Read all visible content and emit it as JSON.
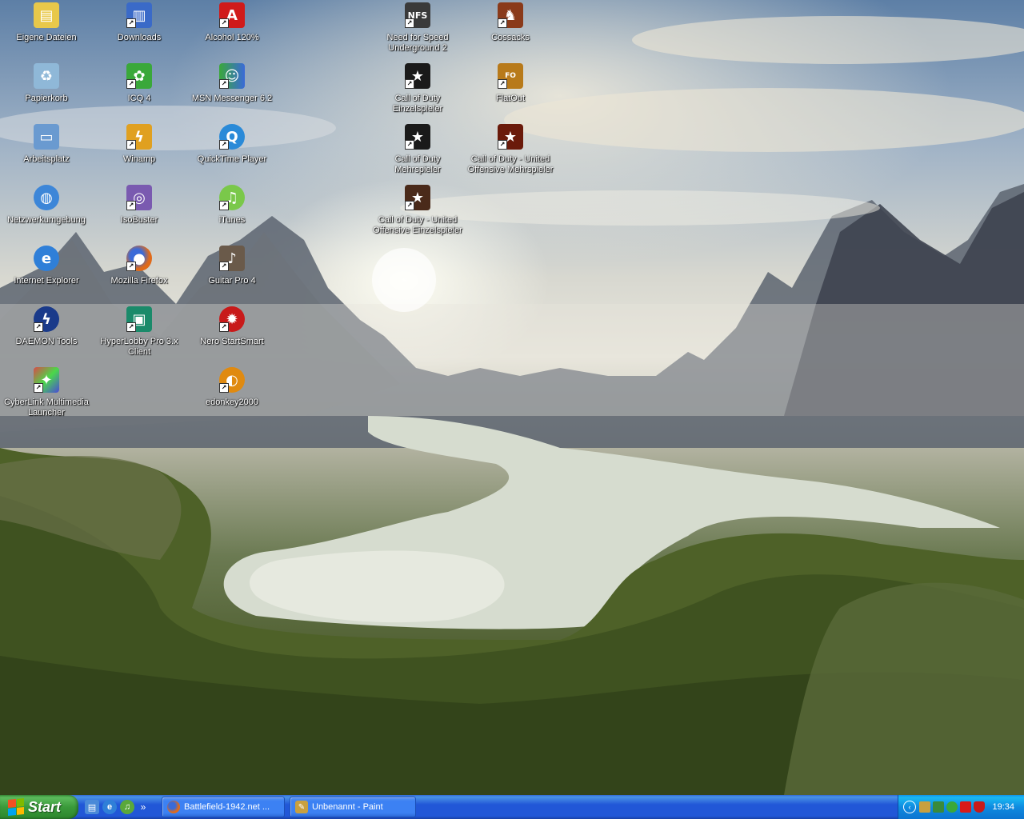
{
  "desktop": {
    "icons": [
      {
        "label": "Eigene Dateien",
        "icon": "my-documents-icon",
        "color": "#e8c84a"
      },
      {
        "label": "Papierkorb",
        "icon": "recycle-bin-icon",
        "color": "#8fb8d8"
      },
      {
        "label": "Arbeitsplatz",
        "icon": "my-computer-icon",
        "color": "#6a9ad0"
      },
      {
        "label": "Netzwerkumgebung",
        "icon": "network-places-icon",
        "color": "#3d86d8"
      },
      {
        "label": "Internet Explorer",
        "icon": "internet-explorer-icon",
        "color": "#2f7fd8"
      },
      {
        "label": "DAEMON Tools",
        "icon": "daemon-tools-icon",
        "color": "#1a3a8a"
      },
      {
        "label": "CyberLink Multimedia Launcher",
        "icon": "cyberlink-icon",
        "color": "#d84a4a"
      },
      {
        "label": "Downloads",
        "icon": "downloads-folder-icon",
        "color": "#3a6ac8"
      },
      {
        "label": "ICQ 4",
        "icon": "icq-flower-icon",
        "color": "#3aa83a"
      },
      {
        "label": "Winamp",
        "icon": "winamp-icon",
        "color": "#e0a020"
      },
      {
        "label": "IsoBuster",
        "icon": "isobuster-icon",
        "color": "#7a5ab0"
      },
      {
        "label": "Mozilla Firefox",
        "icon": "firefox-icon",
        "color": "#e06a1a"
      },
      {
        "label": "HyperLobby Pro 3.x Client",
        "icon": "hyperlobby-icon",
        "color": "#1a8a6a"
      },
      {
        "label": "Alcohol 120%",
        "icon": "alcohol-icon",
        "color": "#d01a1a"
      },
      {
        "label": "MSN Messenger 6.2",
        "icon": "msn-messenger-icon",
        "color": "#3aa83a"
      },
      {
        "label": "QuickTime Player",
        "icon": "quicktime-icon",
        "color": "#2a8ad8"
      },
      {
        "label": "iTunes",
        "icon": "itunes-icon",
        "color": "#7ac84a"
      },
      {
        "label": "Guitar Pro 4",
        "icon": "guitar-pro-icon",
        "color": "#6a5a4a"
      },
      {
        "label": "Nero StartSmart",
        "icon": "nero-icon",
        "color": "#c81a1a"
      },
      {
        "label": "edonkey2000",
        "icon": "edonkey-icon",
        "color": "#e08a10"
      },
      {
        "label": "Need for Speed Underground 2",
        "icon": "nfs-icon",
        "color": "#3a3a3a"
      },
      {
        "label": "Call of Duty Einzelspieler",
        "icon": "cod-star-icon",
        "color": "#1a1a1a"
      },
      {
        "label": "Call of Duty Mehrspieler",
        "icon": "cod-star-icon",
        "color": "#1a1a1a"
      },
      {
        "label": "Call of Duty - United Offensive Einzelspieler",
        "icon": "cod-uo-star-icon",
        "color": "#4a2a1a"
      },
      {
        "label": "Cossacks",
        "icon": "cossacks-icon",
        "color": "#8a3a1a"
      },
      {
        "label": "FlatOut",
        "icon": "flatout-icon",
        "color": "#b87a1a"
      },
      {
        "label": "Call of Duty - United Offensive Mehrspieler",
        "icon": "cod-uo-star-icon",
        "color": "#6a1a0a"
      }
    ]
  },
  "taskbar": {
    "start_label": "Start",
    "quicklaunch": [
      {
        "icon": "show-desktop-icon",
        "color": "#4a8ad8",
        "glyph": "▤"
      },
      {
        "icon": "internet-explorer-icon",
        "color": "#2f7fd8",
        "glyph": "e"
      },
      {
        "icon": "itunes-icon",
        "color": "#5aa83a",
        "glyph": "♫"
      }
    ],
    "more_glyph": "»",
    "tasks": [
      {
        "label": "Battlefield-1942.net ...",
        "icon": "firefox-icon",
        "color": "#e06a1a"
      },
      {
        "label": "Unbenannt - Paint",
        "icon": "paint-icon",
        "color": "#c8a040"
      }
    ],
    "tray": {
      "icons": [
        {
          "icon": "hyperlobby-tray-icon",
          "color": "#c8a040"
        },
        {
          "icon": "network-tray-icon",
          "color": "#3a8a3a"
        },
        {
          "icon": "msn-tray-icon",
          "color": "#3aa83a"
        },
        {
          "icon": "ati-tray-icon",
          "color": "#d81a1a"
        },
        {
          "icon": "antivirus-shield-icon",
          "color": "#c81a1a"
        }
      ],
      "clock": "19:34"
    }
  }
}
